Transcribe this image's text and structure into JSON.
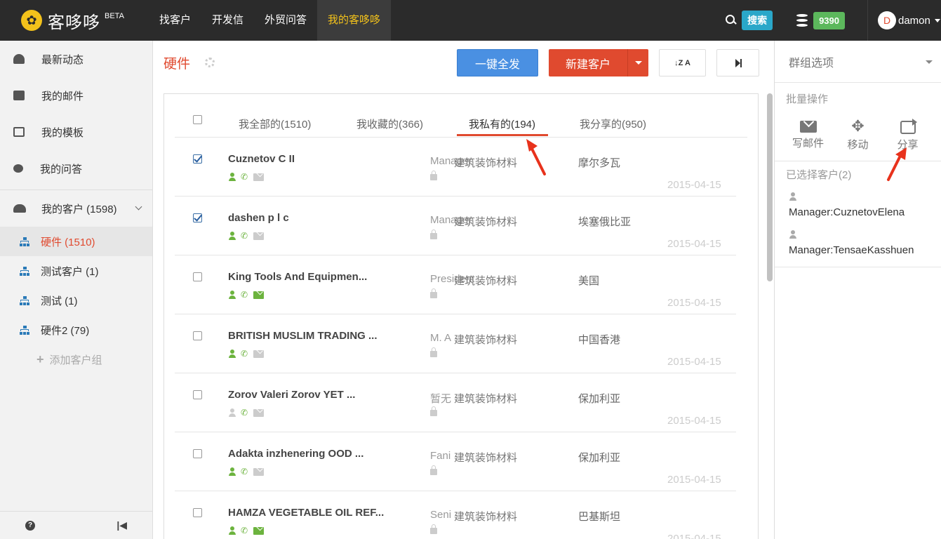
{
  "app": {
    "logo_text": "客哆哆",
    "beta": "BETA",
    "nav": [
      "找客户",
      "开发信",
      "外贸问答",
      "我的客哆哆"
    ],
    "search_label": "搜索",
    "points": "9390",
    "avatar_initial": "D",
    "username": "damon"
  },
  "sidebar": {
    "items": [
      "最新动态",
      "我的邮件",
      "我的模板",
      "我的问答"
    ],
    "group_head": "我的客户 (1598)",
    "groups": [
      "硬件 (1510)",
      "测试客户 (1)",
      "测试 (1)",
      "硬件2 (79)"
    ],
    "add_group": "添加客户组",
    "help": "?"
  },
  "main": {
    "title": "硬件",
    "send_all": "一键全发",
    "new_customer": "新建客户",
    "sort_label": "↓Z A",
    "tabs": [
      "我全部的(1510)",
      "我收藏的(366)",
      "我私有的(194)",
      "我分享的(950)"
    ],
    "rows": [
      {
        "name": "Cuznetov C II",
        "title": "Manager",
        "industry": "建筑装饰材料",
        "country": "摩尔多瓦",
        "date": "2015-04-15",
        "checked": true,
        "person": "green",
        "mail": "gray"
      },
      {
        "name": "dashen p l c",
        "title": "Manager",
        "industry": "建筑装饰材料",
        "country": "埃塞俄比亚",
        "date": "2015-04-15",
        "checked": true,
        "person": "green",
        "mail": "gray"
      },
      {
        "name": "King Tools And Equipmen...",
        "title": "President",
        "industry": "建筑装饰材料",
        "country": "美国",
        "date": "2015-04-15",
        "checked": false,
        "person": "green",
        "mail": "green"
      },
      {
        "name": "BRITISH MUSLIM TRADING ...",
        "title": "M. A",
        "industry": "建筑装饰材料",
        "country": "中国香港",
        "date": "2015-04-15",
        "checked": false,
        "person": "green",
        "mail": "gray"
      },
      {
        "name": "Zorov Valeri Zorov YET ...",
        "title": "暂无",
        "industry": "建筑装饰材料",
        "country": "保加利亚",
        "date": "2015-04-15",
        "checked": false,
        "person": "gray",
        "mail": "gray"
      },
      {
        "name": "Adakta inzhenering OOD ...",
        "title": "Fani",
        "industry": "建筑装饰材料",
        "country": "保加利亚",
        "date": "2015-04-15",
        "checked": false,
        "person": "green",
        "mail": "gray"
      },
      {
        "name": "HAMZA VEGETABLE OIL REF...",
        "title": "Seni",
        "industry": "建筑装饰材料",
        "country": "巴基斯坦",
        "date": "2015-04-15",
        "checked": false,
        "person": "green",
        "mail": "green"
      }
    ]
  },
  "rpanel": {
    "head": "群组选项",
    "batch": "批量操作",
    "actions": [
      "写邮件",
      "移动",
      "分享"
    ],
    "selected": "已选择客户(2)",
    "contacts": [
      "Manager:CuznetovElena",
      "Manager:TensaeKasshuen"
    ]
  },
  "colors": {
    "accent_red": "#e04a2f",
    "blue": "#4a90e2",
    "green_icon": "#6cb33e",
    "topbar": "#2b2b2b",
    "active_nav": "#f3c21b"
  }
}
